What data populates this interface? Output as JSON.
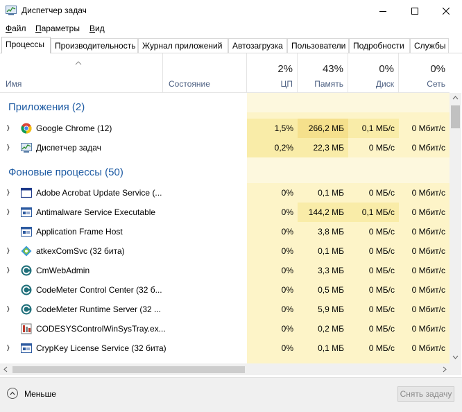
{
  "window": {
    "title": "Диспетчер задач"
  },
  "menu": [
    {
      "label": "Файл",
      "hotkey": "Ф",
      "rest": "айл"
    },
    {
      "label": "Параметры",
      "hotkey": "П",
      "rest": "араметры"
    },
    {
      "label": "Вид",
      "hotkey": "В",
      "rest": "ид"
    }
  ],
  "tabs": [
    "Процессы",
    "Производительность",
    "Журнал приложений",
    "Автозагрузка",
    "Пользователи",
    "Подробности",
    "Службы"
  ],
  "columns": {
    "name": "Имя",
    "status": "Состояние",
    "cpu": {
      "pct": "2%",
      "label": "ЦП"
    },
    "memory": {
      "pct": "43%",
      "label": "Память"
    },
    "disk": {
      "pct": "0%",
      "label": "Диск"
    },
    "network": {
      "pct": "0%",
      "label": "Сеть"
    }
  },
  "groups": {
    "apps": "Приложения (2)",
    "background": "Фоновые процессы (50)"
  },
  "apps": [
    {
      "name": "Google Chrome (12)",
      "icon": "chrome-icon",
      "cpu": "1,5%",
      "memory": "266,2 МБ",
      "disk": "0,1 МБ/с",
      "network": "0 Мбит/с"
    },
    {
      "name": "Диспетчер задач",
      "icon": "task-manager-icon",
      "cpu": "0,2%",
      "memory": "22,3 МБ",
      "disk": "0 МБ/с",
      "network": "0 Мбит/с"
    }
  ],
  "background": [
    {
      "name": "Adobe Acrobat Update Service (...",
      "icon": "window-icon",
      "expandable": true,
      "cpu": "0%",
      "memory": "0,1 МБ",
      "disk": "0 МБ/с",
      "network": "0 Мбит/с"
    },
    {
      "name": "Antimalware Service Executable",
      "icon": "service-icon",
      "expandable": true,
      "cpu": "0%",
      "memory": "144,2 МБ",
      "disk": "0,1 МБ/с",
      "network": "0 Мбит/с"
    },
    {
      "name": "Application Frame Host",
      "icon": "service-icon",
      "expandable": false,
      "cpu": "0%",
      "memory": "3,8 МБ",
      "disk": "0 МБ/с",
      "network": "0 Мбит/с"
    },
    {
      "name": "atkexComSvc (32 бита)",
      "icon": "atk-icon",
      "expandable": true,
      "cpu": "0%",
      "memory": "0,1 МБ",
      "disk": "0 МБ/с",
      "network": "0 Мбит/с"
    },
    {
      "name": "CmWebAdmin",
      "icon": "codemeter-icon",
      "expandable": true,
      "cpu": "0%",
      "memory": "3,3 МБ",
      "disk": "0 МБ/с",
      "network": "0 Мбит/с"
    },
    {
      "name": "CodeMeter Control Center (32 б...",
      "icon": "codemeter-icon",
      "expandable": false,
      "cpu": "0%",
      "memory": "0,5 МБ",
      "disk": "0 МБ/с",
      "network": "0 Мбит/с"
    },
    {
      "name": "CodeMeter Runtime Server (32 ...",
      "icon": "codemeter-icon",
      "expandable": true,
      "cpu": "0%",
      "memory": "5,9 МБ",
      "disk": "0 МБ/с",
      "network": "0 Мбит/с"
    },
    {
      "name": "CODESYSControlWinSysTray.ex...",
      "icon": "codesys-icon",
      "expandable": false,
      "cpu": "0%",
      "memory": "0,2 МБ",
      "disk": "0 МБ/с",
      "network": "0 Мбит/с"
    },
    {
      "name": "CrypKey License Service (32 бита)",
      "icon": "service-icon",
      "expandable": true,
      "cpu": "0%",
      "memory": "0,1 МБ",
      "disk": "0 МБ/с",
      "network": "0 Мбит/с"
    }
  ],
  "footer": {
    "fewer": "Меньше",
    "end_task": "Снять задачу"
  },
  "colors": {
    "heat_light": "#fff4c4",
    "heat_mid": "#f9eca8",
    "heat_strong": "#f5e08c",
    "group_title": "#1e5ba3",
    "heat_empty": "#fdf8de"
  }
}
